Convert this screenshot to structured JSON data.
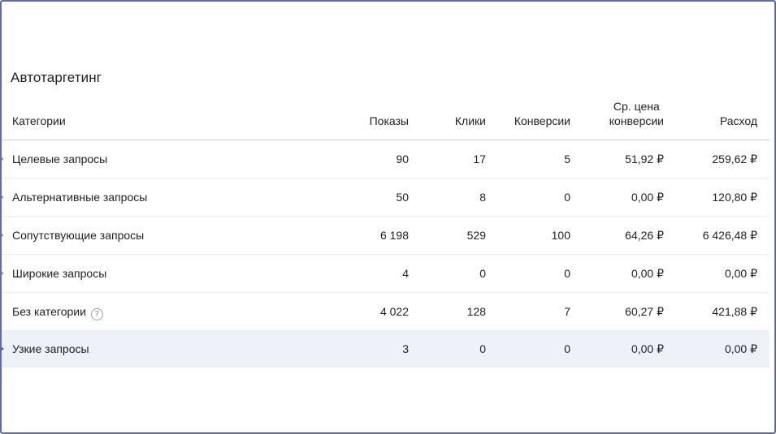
{
  "section": {
    "title": "Автотаргетинг"
  },
  "table": {
    "headers": {
      "category": "Категории",
      "shows": "Показы",
      "clicks": "Клики",
      "conversions": "Конверсии",
      "avg_price_line1": "Ср. цена",
      "avg_price_line2": "конверсии",
      "cost": "Расход"
    },
    "rows": [
      {
        "category": "Целевые запросы",
        "shows": "90",
        "clicks": "17",
        "conversions": "5",
        "avg_price": "51,92 ₽",
        "cost": "259,62 ₽"
      },
      {
        "category": "Альтернативные запросы",
        "shows": "50",
        "clicks": "8",
        "conversions": "0",
        "avg_price": "0,00 ₽",
        "cost": "120,80 ₽"
      },
      {
        "category": "Сопутствующие запросы",
        "shows": "6 198",
        "clicks": "529",
        "conversions": "100",
        "avg_price": "64,26 ₽",
        "cost": "6 426,48 ₽"
      },
      {
        "category": "Широкие запросы",
        "shows": "4",
        "clicks": "0",
        "conversions": "0",
        "avg_price": "0,00 ₽",
        "cost": "0,00 ₽"
      },
      {
        "category": "Без категории",
        "shows": "4 022",
        "clicks": "128",
        "conversions": "7",
        "avg_price": "60,27 ₽",
        "cost": "421,88 ₽"
      },
      {
        "category": "Узкие запросы",
        "shows": "3",
        "clicks": "0",
        "conversions": "0",
        "avg_price": "0,00 ₽",
        "cost": "0,00 ₽"
      }
    ]
  },
  "icons": {
    "help": "question-circle-icon",
    "row_marker": "triangle-right-icon"
  },
  "colors": {
    "frame_border": "#5d6cb0",
    "highlight_row": "#eef1f8"
  }
}
